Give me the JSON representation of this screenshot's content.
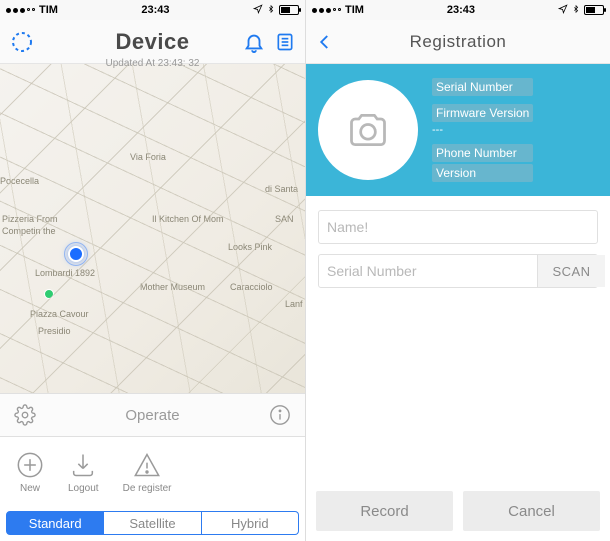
{
  "status": {
    "carrier": "TIM",
    "time": "23:43"
  },
  "left": {
    "nav": {
      "title": "Device",
      "subtitle": "Updated At 23:43: 32"
    },
    "map_labels": {
      "kitchen": "Il Kitchen Of Mom",
      "looks": "Looks Pink",
      "lombardi": "Lombardi 1892",
      "mother": "Mother Museum",
      "piazza": "Piazza Cavour",
      "presidio": "Presidio",
      "pizzeria": "Pizzeria From",
      "competin": "Competin the",
      "foria": "Via Foria",
      "caracciolo": "Caracciolo",
      "san": "SAN",
      "lanf": "Lanf",
      "santa": "di Santa",
      "poccella": "Pocecella"
    },
    "operate": "Operate",
    "actions": {
      "new": "New",
      "logout": "Logout",
      "deregister": "De register"
    },
    "segments": {
      "standard": "Standard",
      "satellite": "Satellite",
      "hybrid": "Hybrid"
    }
  },
  "right": {
    "nav": {
      "title": "Registration"
    },
    "info": {
      "serial_label": "Serial Number",
      "firmware_label": "Firmware Version",
      "firmware_value": "---",
      "phone_label": "Phone Number",
      "version_label": "Version"
    },
    "form": {
      "name_placeholder": "Name!",
      "serial_placeholder": "Serial Number",
      "scan": "SCAN"
    },
    "buttons": {
      "record": "Record",
      "cancel": "Cancel"
    }
  }
}
